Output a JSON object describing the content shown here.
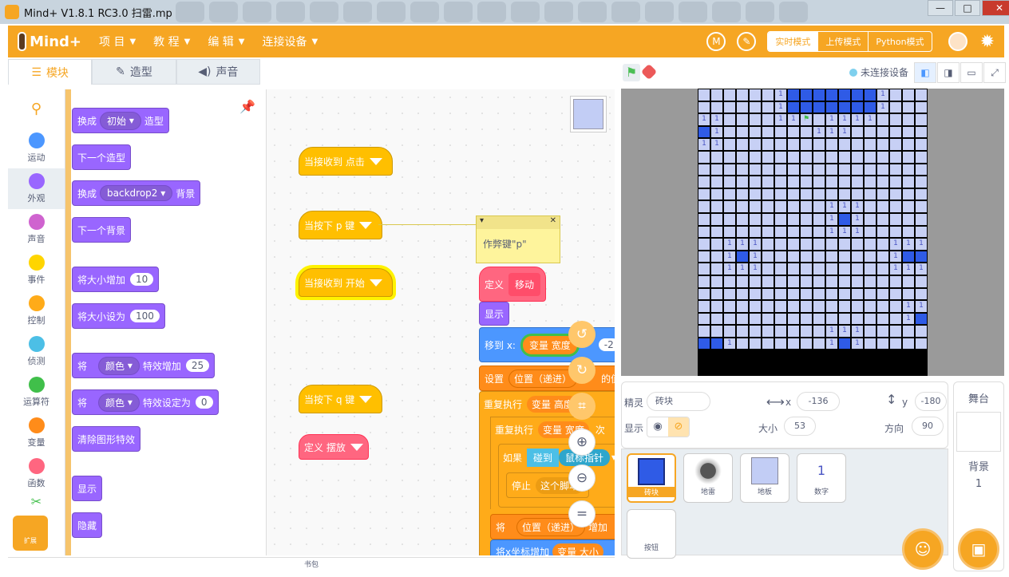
{
  "window": {
    "title": "Mind+ V1.8.1 RC3.0   扫雷.mp"
  },
  "menu": {
    "logo": "Mind+",
    "items": [
      "项 目",
      "教 程",
      "编 辑",
      "连接设备"
    ],
    "modes": [
      "实时模式",
      "上传模式",
      "Python模式"
    ]
  },
  "tabs": [
    "模块",
    "造型",
    "声音"
  ],
  "categories": [
    {
      "label": "运动",
      "color": "#4c97ff"
    },
    {
      "label": "外观",
      "color": "#9966ff"
    },
    {
      "label": "声音",
      "color": "#cf63cf"
    },
    {
      "label": "事件",
      "color": "#ffd500"
    },
    {
      "label": "控制",
      "color": "#ffab19"
    },
    {
      "label": "侦测",
      "color": "#4cbfe6"
    },
    {
      "label": "运算符",
      "color": "#40bf4a"
    },
    {
      "label": "变量",
      "color": "#ff8c1a"
    },
    {
      "label": "函数",
      "color": "#ff6680"
    }
  ],
  "extension_label": "扩展",
  "palette": {
    "switch_costume": {
      "pre": "换成",
      "menu": "初始",
      "post": "造型"
    },
    "next_costume": "下一个造型",
    "switch_backdrop": {
      "pre": "换成",
      "menu": "backdrop2",
      "post": "背景"
    },
    "next_backdrop": "下一个背景",
    "change_size": {
      "label": "将大小增加",
      "value": "10"
    },
    "set_size": {
      "label": "将大小设为",
      "value": "100"
    },
    "change_effect": {
      "pre": "将",
      "menu": "颜色",
      "post": "特效增加",
      "value": "25"
    },
    "set_effect": {
      "pre": "将",
      "menu": "颜色",
      "post": "特效设定为",
      "value": "0"
    },
    "clear_effects": "清除图形特效",
    "show": "显示",
    "hide": "隐藏"
  },
  "script": {
    "hat1": "当接收到 点击",
    "hat2": "当按下 p 键",
    "hat3": "当接收到 开始",
    "hat4": "当按下 q 键",
    "def_place": "定义 摆放",
    "note": {
      "text": "作弊键\"p\""
    },
    "def_move": {
      "pre": "定义",
      "name": "移动"
    },
    "show": "显示",
    "move_to": {
      "pre": "移到 x:",
      "var": "变量 宽度",
      "val": "-2"
    },
    "set_pos": {
      "pre": "设置",
      "var": "位置（递进）",
      "post": "的值为"
    },
    "repeat1": {
      "pre": "重复执行",
      "var": "变量 高度",
      "post": "次"
    },
    "repeat2": {
      "pre": "重复执行",
      "var": "变量 宽度",
      "post": "次"
    },
    "if": {
      "pre": "如果",
      "cond": "碰到",
      "menu": "鼠标指针"
    },
    "stop": {
      "pre": "停止",
      "menu": "这个脚本"
    },
    "change_pos": {
      "pre": "将",
      "var": "位置（递进）",
      "post": "增加"
    },
    "change_x": {
      "pre": "将x坐标增加",
      "var": "变量 大小"
    }
  },
  "backpack": "书包",
  "stage_bar": {
    "status": "未连接设备"
  },
  "board": {
    "cols": 18,
    "rows": [
      "......1bbbbbbb1...",
      "......1bbbbbbb1...",
      "11....11F.1111....",
      "B1.......111......",
      "11................",
      "..................",
      "..................",
      "..................",
      "..................",
      "..........111.....",
      "..........1B1.....",
      "..........111.....",
      "..111..........111",
      "..1B1..........1BB",
      "..111..........111",
      "..................",
      "..................",
      "................11",
      "................1B",
      "..........111.....",
      "BB1.......1B1....."
    ]
  },
  "sprite_info": {
    "name_label": "精灵",
    "name": "砖块",
    "x_label": "x",
    "x": "-136",
    "y_label": "y",
    "y": "-180",
    "show_label": "显示",
    "size_label": "大小",
    "size": "53",
    "dir_label": "方向",
    "dir": "90"
  },
  "sprites": [
    "砖块",
    "地雷",
    "地板",
    "数字",
    "按钮"
  ],
  "sprite_number_glyph": "1",
  "stage_panel": {
    "title": "舞台",
    "backdrop_label": "背景",
    "backdrop_count": "1"
  }
}
